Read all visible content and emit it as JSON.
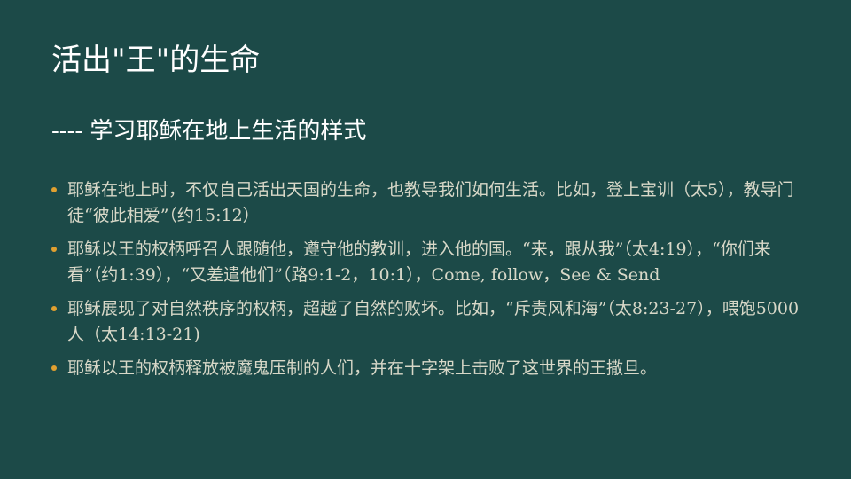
{
  "slide": {
    "title": "活出\"王\"的生命",
    "subtitle": "---- 学习耶稣在地上生活的样式",
    "bullets": [
      "耶稣在地上时，不仅自己活出天国的生命，也教导我们如何生活。比如，登上宝训（太5），教导门徒“彼此相爱”（约15:12）",
      "耶稣以王的权柄呼召人跟随他，遵守他的教训，进入他的国。“来，跟从我”（太4:19），“你们来看”（约1:39），“又差遣他们”（路9:1-2，10:1），Come, follow，See & Send",
      "耶稣展现了对自然秩序的权柄，超越了自然的败坏。比如，“斥责风和海”（太8:23-27），喂饱5000人（太14:13-21)",
      "耶稣以王的权柄释放被魔鬼压制的人们，并在十字架上击败了这世界的王撒旦。"
    ]
  },
  "colors": {
    "background": "#1c4a48",
    "title_text": "#ffffff",
    "body_text": "#d8d8c8",
    "bullet_dot": "#e0a030"
  }
}
